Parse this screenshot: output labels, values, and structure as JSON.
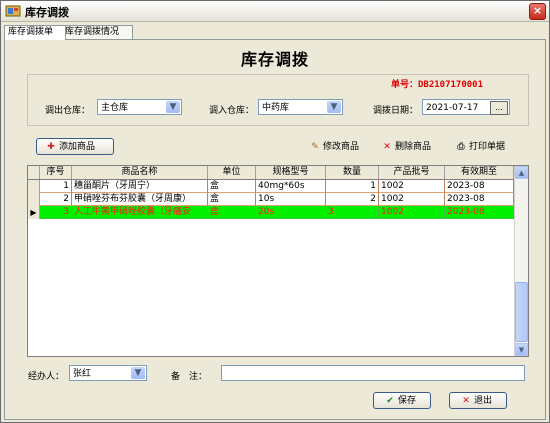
{
  "window": {
    "title": "库存调拨",
    "close_glyph": "×"
  },
  "tabs": [
    {
      "label": "库存调拨单"
    },
    {
      "label": "库存调拨情况"
    }
  ],
  "header": {
    "title": "库存调拨",
    "doc_no": "单号：DB2107170001"
  },
  "filters": {
    "out_label": "调出仓库：",
    "out_value": "主仓库",
    "in_label": "调入仓库：",
    "in_value": "中药库",
    "date_label": "调拨日期：",
    "date_value": "2021-07-17",
    "date_btn": "..."
  },
  "toolbar": {
    "add_label": "添加商品",
    "edit_label": "修改商品",
    "delete_label": "删除商品",
    "print_label": "打印单据"
  },
  "table": {
    "columns": [
      "序号",
      "商品名称",
      "单位",
      "规格型号",
      "数量",
      "产品批号",
      "有效期至"
    ],
    "rows": [
      {
        "no": "1",
        "name": "穗甾酮片（牙周宁）",
        "unit": "盒",
        "spec": "40mg*60s",
        "qty": "1",
        "batch": "1002",
        "expiry": "2023-08"
      },
      {
        "no": "2",
        "name": "甲硝唑芬布芬胶囊（牙周康）",
        "unit": "盒",
        "spec": "10s",
        "qty": "2",
        "batch": "1002",
        "expiry": "2023-08"
      },
      {
        "no": "3",
        "name": "人工牛黄甲硝唑胶囊（牙痛安",
        "unit": "盒",
        "spec": "20s",
        "qty": "3",
        "batch": "1002",
        "expiry": "2023-08"
      }
    ]
  },
  "footer": {
    "handler_label": "经办人：",
    "handler_value": "张红",
    "remark_label": "备　注：",
    "remark_value": "",
    "save_label": "保存",
    "exit_label": "退出"
  },
  "colors": {
    "selected_row_bg": "#00f000",
    "selected_row_text": "#ff1a1a",
    "doc_no": "#e00000"
  }
}
